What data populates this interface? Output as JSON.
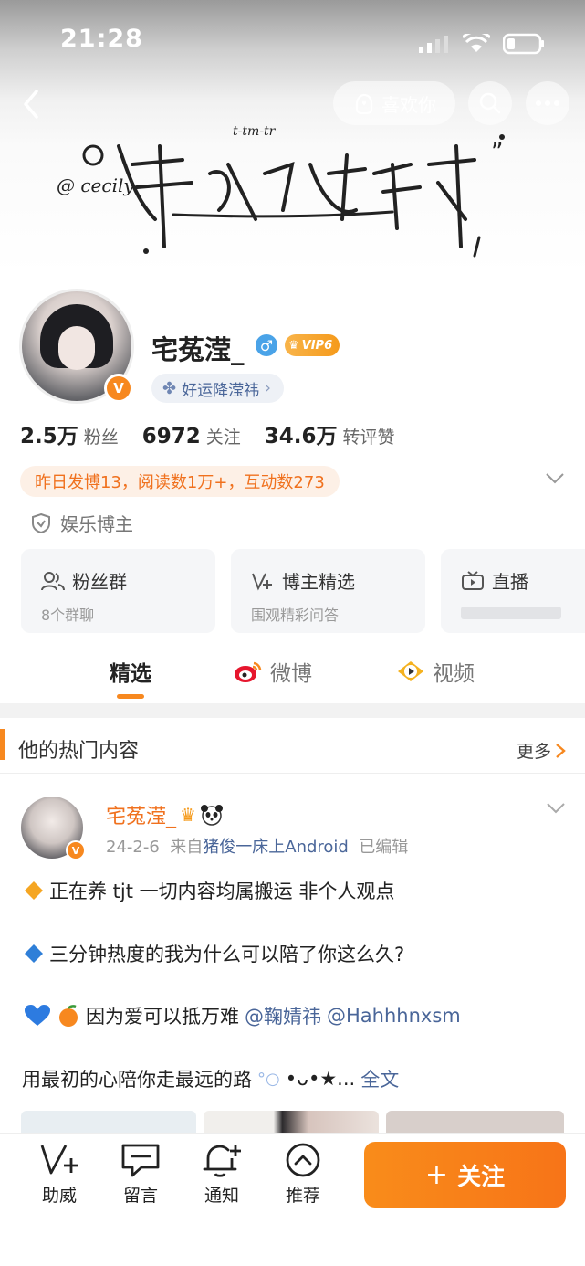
{
  "status_bar": {
    "time": "21:28"
  },
  "header": {
    "like_label": "喜欢你"
  },
  "profile": {
    "name": "宅菟滢_",
    "vip_label": "VIP6",
    "fortune_label": "好运降滢祎",
    "stats": [
      {
        "value": "2.5万",
        "label": "粉丝"
      },
      {
        "value": "6972",
        "label": "关注"
      },
      {
        "value": "34.6万",
        "label": "转评赞"
      }
    ],
    "activity": "昨日发博13，阅读数1万+，互动数273",
    "tag": "娱乐博主"
  },
  "cards": [
    {
      "title": "粉丝群",
      "subtitle": "8个群聊",
      "icon": "group-icon"
    },
    {
      "title": "博主精选",
      "subtitle": "围观精彩问答",
      "icon": "v-plus-icon"
    },
    {
      "title": "直播",
      "subtitle": "",
      "icon": "live-tv-icon"
    }
  ],
  "tabs": [
    {
      "label": "精选"
    },
    {
      "label": "微博"
    },
    {
      "label": "视频"
    }
  ],
  "hot": {
    "title": "他的热门内容",
    "more_label": "更多"
  },
  "post": {
    "author": "宅菟滢_",
    "date": "24-2-6",
    "from": "来自",
    "source": "猪俊一床上Android",
    "edited": "已编辑",
    "line1": "正在养 tjt 一切内容均属搬运 非个人观点",
    "line2": "三分钟热度的我为什么可以陪了你这么久?",
    "line3": "因为爱可以抵万难",
    "mention1": "@鞠婧祎",
    "mention2": "@Hahhhnxsm",
    "line4": "用最初的心陪你走最远的路",
    "line4_tail": "•ᴗ•★...",
    "full_text": "全文"
  },
  "bottom_bar": {
    "items": [
      {
        "label": "助威",
        "icon": "v-plus-icon"
      },
      {
        "label": "留言",
        "icon": "comment-icon"
      },
      {
        "label": "通知",
        "icon": "bell-plus-icon"
      },
      {
        "label": "推荐",
        "icon": "recommend-icon"
      }
    ],
    "follow_label": "关注"
  },
  "colors": {
    "accent": "#f7881f",
    "link": "#4a6699"
  }
}
